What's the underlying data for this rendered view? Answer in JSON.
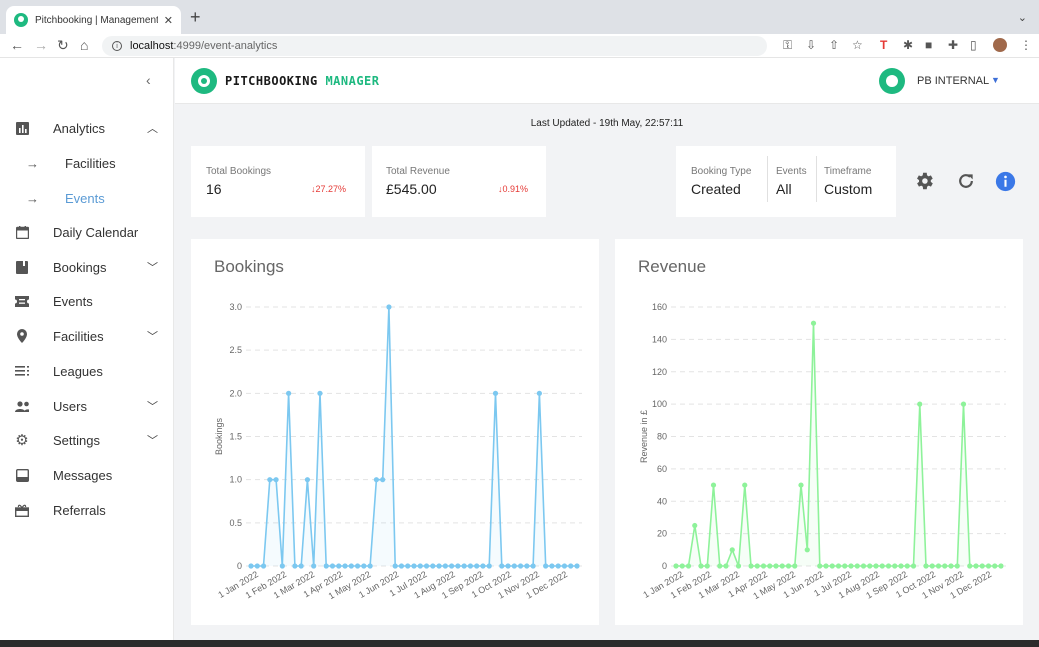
{
  "browser": {
    "tab_title": "Pitchbooking | Management C",
    "url_host": "localhost",
    "url_path": ":4999/event-analytics"
  },
  "brand": {
    "name_part1": "PITCHBOOKING",
    "name_part2": "MANAGER",
    "color": "#1eb980"
  },
  "user": {
    "name": "PB INTERNAL"
  },
  "sidebar": {
    "items": [
      {
        "label": "Analytics",
        "icon": "bar-chart-icon",
        "chevron": "up"
      },
      {
        "label": "Facilities",
        "sub": true
      },
      {
        "label": "Events",
        "sub": true,
        "active": true
      },
      {
        "label": "Daily Calendar",
        "icon": "calendar-icon"
      },
      {
        "label": "Bookings",
        "icon": "book-icon",
        "chevron": "down"
      },
      {
        "label": "Events",
        "icon": "ticket-icon"
      },
      {
        "label": "Facilities",
        "icon": "location-pin-icon",
        "chevron": "down"
      },
      {
        "label": "Leagues",
        "icon": "list-icon"
      },
      {
        "label": "Users",
        "icon": "users-icon",
        "chevron": "down"
      },
      {
        "label": "Settings",
        "icon": "gear-icon",
        "chevron": "down"
      },
      {
        "label": "Messages",
        "icon": "inbox-icon"
      },
      {
        "label": "Referrals",
        "icon": "gift-icon"
      }
    ]
  },
  "last_updated": "Last Updated - 19th May, 22:57:11",
  "stats": {
    "bookings": {
      "label": "Total Bookings",
      "value": "16",
      "change": "↓27.27%"
    },
    "revenue": {
      "label": "Total Revenue",
      "value": "£545.00",
      "change": "↓0.91%"
    }
  },
  "filters": {
    "booking_type": {
      "label": "Booking Type",
      "value": "Created"
    },
    "events": {
      "label": "Events",
      "value": "All"
    },
    "timeframe": {
      "label": "Timeframe",
      "value": "Custom"
    }
  },
  "chart_data": [
    {
      "type": "line",
      "title": "Bookings",
      "ylabel": "Bookings",
      "color": "#7cc8f0",
      "ylim": [
        0,
        3
      ],
      "yticks": [
        "0",
        "0.5",
        "1.0",
        "1.5",
        "2.0",
        "2.5",
        "3.0"
      ],
      "xticks": [
        "1 Jan 2022",
        "1 Feb 2022",
        "1 Mar 2022",
        "1 Apr 2022",
        "1 May 2022",
        "1 Jun 2022",
        "1 Jul 2022",
        "1 Aug 2022",
        "1 Sep 2022",
        "1 Oct 2022",
        "1 Nov 2022",
        "1 Dec 2022"
      ],
      "values": [
        0,
        0,
        0,
        1,
        1,
        0,
        2,
        0,
        0,
        1,
        0,
        2,
        0,
        0,
        0,
        0,
        0,
        0,
        0,
        0,
        1,
        1,
        3,
        0,
        0,
        0,
        0,
        0,
        0,
        0,
        0,
        0,
        0,
        0,
        0,
        0,
        0,
        0,
        0,
        2,
        0,
        0,
        0,
        0,
        0,
        0,
        2,
        0,
        0,
        0,
        0,
        0,
        0
      ]
    },
    {
      "type": "line",
      "title": "Revenue",
      "ylabel": "Revenue in £",
      "color": "#8ef29a",
      "ylim": [
        0,
        160
      ],
      "yticks": [
        "0",
        "20",
        "40",
        "60",
        "80",
        "100",
        "120",
        "140",
        "160"
      ],
      "xticks": [
        "1 Jan 2022",
        "1 Feb 2022",
        "1 Mar 2022",
        "1 Apr 2022",
        "1 May 2022",
        "1 Jun 2022",
        "1 Jul 2022",
        "1 Aug 2022",
        "1 Sep 2022",
        "1 Oct 2022",
        "1 Nov 2022",
        "1 Dec 2022"
      ],
      "values": [
        0,
        0,
        0,
        25,
        0,
        0,
        50,
        0,
        0,
        10,
        0,
        50,
        0,
        0,
        0,
        0,
        0,
        0,
        0,
        0,
        50,
        10,
        150,
        0,
        0,
        0,
        0,
        0,
        0,
        0,
        0,
        0,
        0,
        0,
        0,
        0,
        0,
        0,
        0,
        100,
        0,
        0,
        0,
        0,
        0,
        0,
        100,
        0,
        0,
        0,
        0,
        0,
        0
      ]
    }
  ]
}
